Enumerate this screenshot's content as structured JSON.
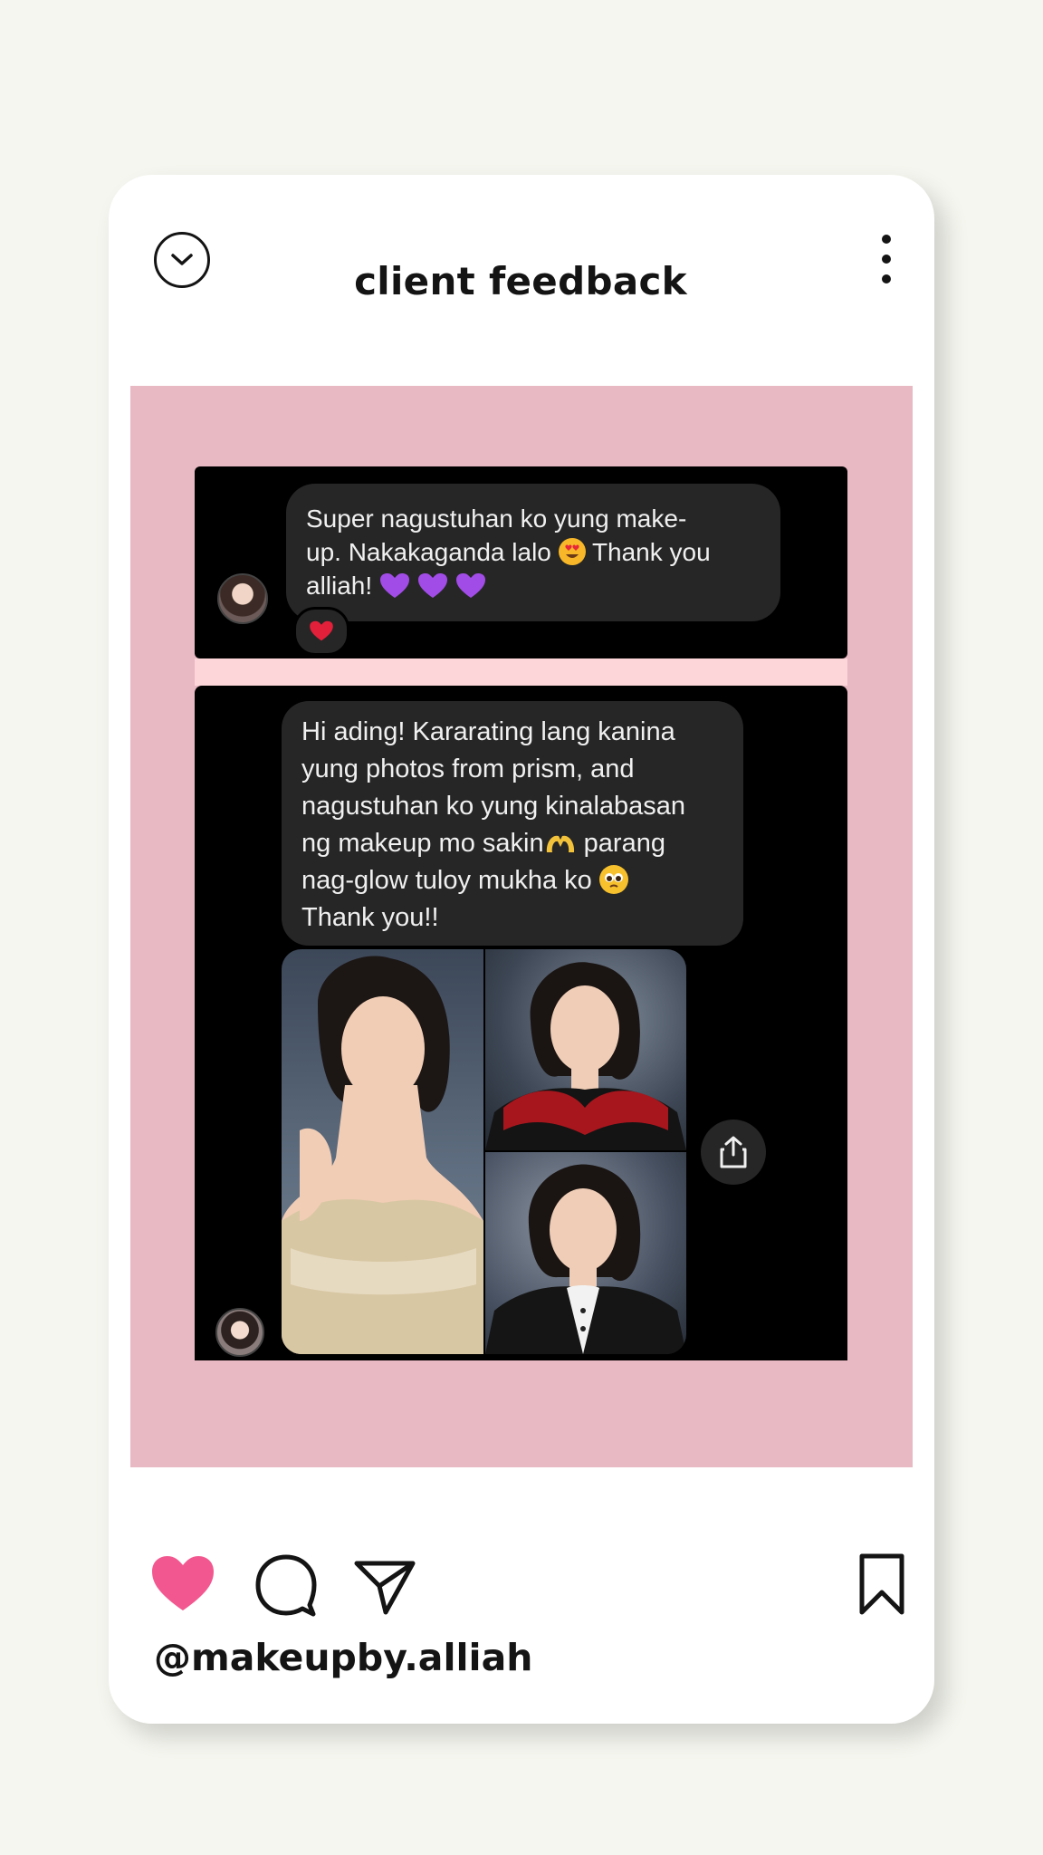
{
  "header": {
    "title": "client feedback"
  },
  "message1": {
    "lines": [
      "Super nagustuhan ko yung make-",
      "up. Nakakaganda lalo",
      "Thank you",
      "alliah!"
    ],
    "reaction_icon": "red-heart-icon"
  },
  "message2": {
    "lines": [
      "Hi ading! Kararating lang kanina",
      "yung photos from prism, and",
      "nagustuhan ko yung kinalabasan",
      "ng makeup mo sakin",
      "parang",
      "nag-glow tuloy mukha ko",
      "Thank you!!"
    ]
  },
  "footer": {
    "username": "@makeupby.alliah",
    "like_color": "#f2588f"
  },
  "colors": {
    "page_bg": "#f5f6ef",
    "panel_pink": "#e8b8c3",
    "bubble_bg": "#262626"
  }
}
